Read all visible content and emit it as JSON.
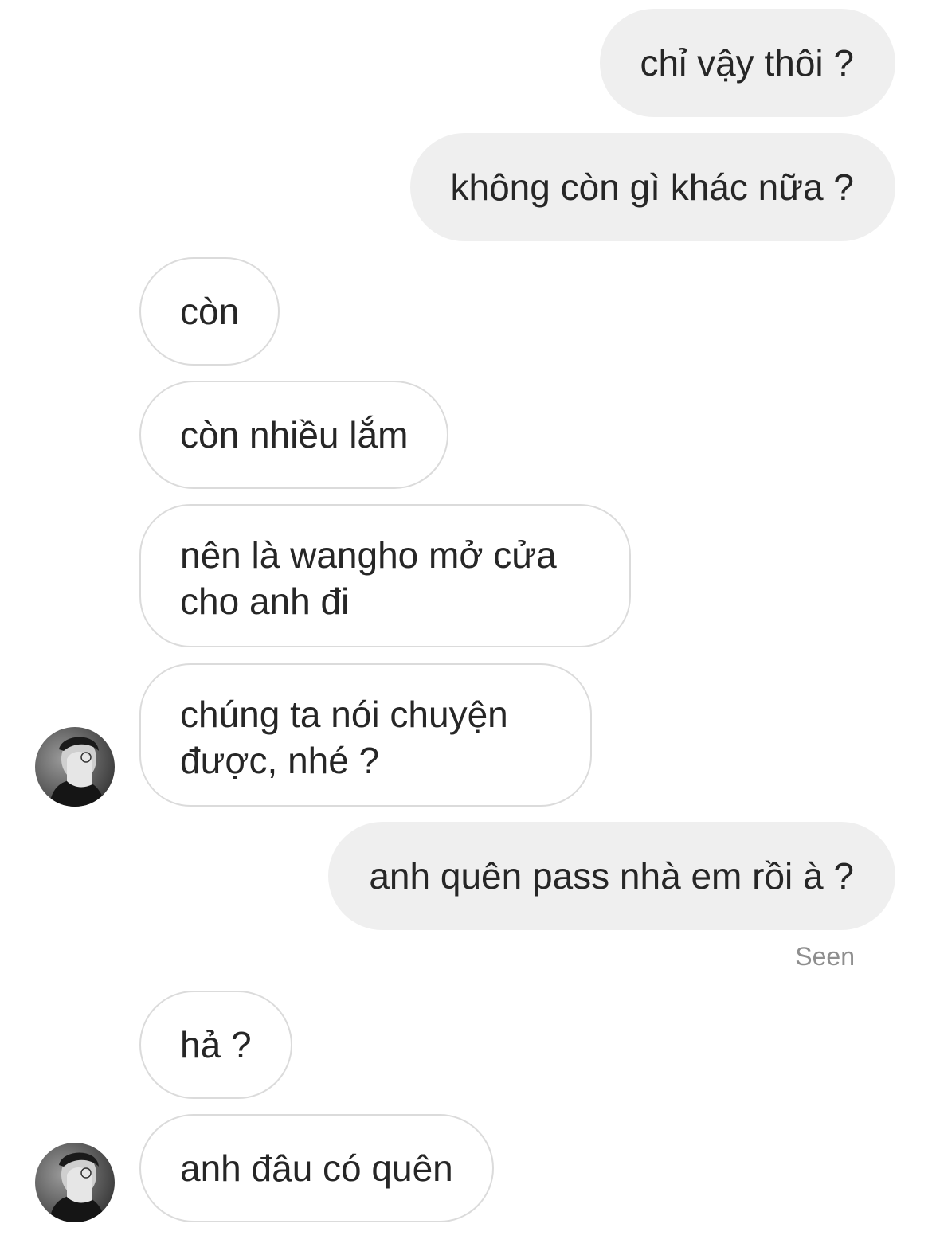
{
  "messages": [
    {
      "text": "chỉ vậy thôi ?"
    },
    {
      "text": "không còn gì khác nữa ?"
    },
    {
      "text": "còn"
    },
    {
      "text": "còn nhiều lắm"
    },
    {
      "text": "nên là wangho mở cửa cho anh đi"
    },
    {
      "text": "chúng ta nói chuyện được, nhé ?"
    },
    {
      "text": "anh quên pass nhà em rồi à ?"
    },
    {
      "text": "hả ?"
    },
    {
      "text": "anh đâu có quên"
    }
  ],
  "seen_label": "Seen",
  "avatar": {
    "icon": "profile-avatar",
    "tone": "grayscale"
  },
  "colors": {
    "outgoing_bubble": "#efefef",
    "incoming_border": "#dbdbdb",
    "text": "#262626",
    "seen_text": "#8e8e8e"
  }
}
